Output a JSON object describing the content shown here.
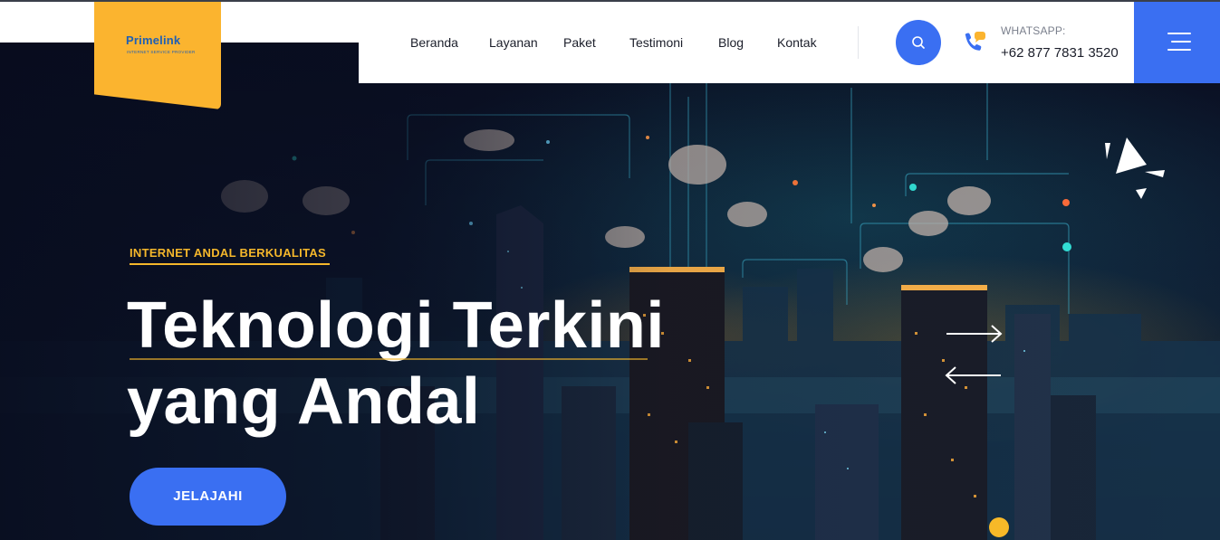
{
  "brand": {
    "name": "Primelink",
    "tagline": "INTERNET SERVICE PROVIDER"
  },
  "nav": {
    "items": [
      "Beranda",
      "Layanan",
      "Paket",
      "Testimoni",
      "Blog",
      "Kontak"
    ]
  },
  "contact": {
    "label": "WHATSAPP:",
    "number": "+62 877 7831 3520"
  },
  "hero": {
    "eyebrow": "INTERNET ANDAL BERKUALITAS",
    "headline_line1": "Teknologi Terkini",
    "headline_line2": "yang Andal",
    "cta_label": "JELAJAHI"
  },
  "colors": {
    "accent_blue": "#3a6ff2",
    "accent_yellow": "#fbb42f",
    "text_dark": "#1b1e2a"
  },
  "icons": [
    "search-icon",
    "phone-chat-icon",
    "hamburger-menu-icon",
    "arrow-right-icon",
    "arrow-left-icon"
  ]
}
